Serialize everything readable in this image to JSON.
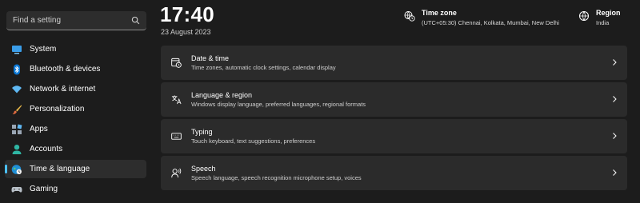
{
  "search": {
    "placeholder": "Find a setting",
    "icon": "search-icon"
  },
  "sidebar": {
    "items": [
      {
        "label": "System",
        "icon": "system-icon"
      },
      {
        "label": "Bluetooth & devices",
        "icon": "bluetooth-icon"
      },
      {
        "label": "Network & internet",
        "icon": "wifi-icon"
      },
      {
        "label": "Personalization",
        "icon": "brush-icon"
      },
      {
        "label": "Apps",
        "icon": "apps-icon"
      },
      {
        "label": "Accounts",
        "icon": "account-icon"
      },
      {
        "label": "Time & language",
        "icon": "globe-clock-icon",
        "selected": true
      },
      {
        "label": "Gaming",
        "icon": "gamepad-icon"
      }
    ]
  },
  "header": {
    "time": "17:40",
    "date": "23 August 2023",
    "timezone": {
      "title": "Time zone",
      "value": "(UTC+05:30) Chennai, Kolkata, Mumbai, New Delhi",
      "icon": "timezone-icon"
    },
    "region": {
      "title": "Region",
      "value": "India",
      "icon": "globe-icon"
    }
  },
  "cards": [
    {
      "title": "Date & time",
      "subtitle": "Time zones, automatic clock settings, calendar display",
      "icon": "calendar-clock-icon"
    },
    {
      "title": "Language & region",
      "subtitle": "Windows display language, preferred languages, regional formats",
      "icon": "language-icon"
    },
    {
      "title": "Typing",
      "subtitle": "Touch keyboard, text suggestions, preferences",
      "icon": "keyboard-icon"
    },
    {
      "title": "Speech",
      "subtitle": "Speech language, speech recognition microphone setup, voices",
      "icon": "speech-icon"
    }
  ],
  "colors": {
    "accent": "#4cc2ff",
    "background": "#1c1c1c",
    "card": "#2b2b2b"
  }
}
